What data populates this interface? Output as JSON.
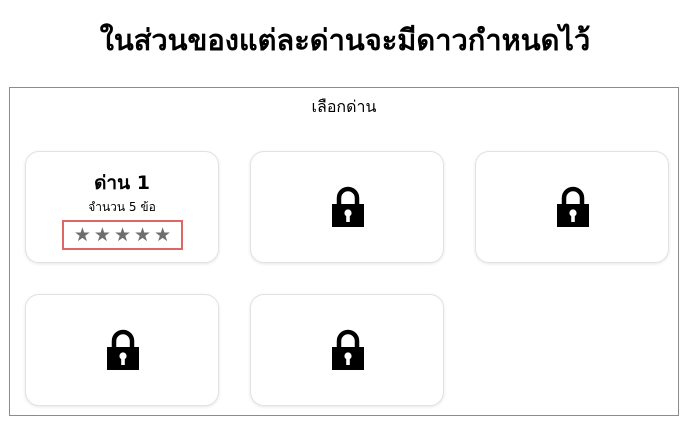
{
  "header": {
    "title": "ในส่วนของแต่ละด่านจะมีดาวกำหนดไว้"
  },
  "level_select": {
    "title": "เลือกด่าน",
    "levels": [
      {
        "name": "ด่าน 1",
        "question_count": "จำนวน 5 ข้อ",
        "stars": 5,
        "locked": false
      },
      {
        "locked": true,
        "icon": "lock-icon"
      },
      {
        "locked": true,
        "icon": "lock-icon"
      },
      {
        "locked": true,
        "icon": "lock-icon"
      },
      {
        "locked": true,
        "icon": "lock-icon"
      }
    ]
  },
  "colors": {
    "star": "#6e6e6e",
    "highlight_border": "#e06666",
    "panel_border": "#8c8c8c"
  }
}
